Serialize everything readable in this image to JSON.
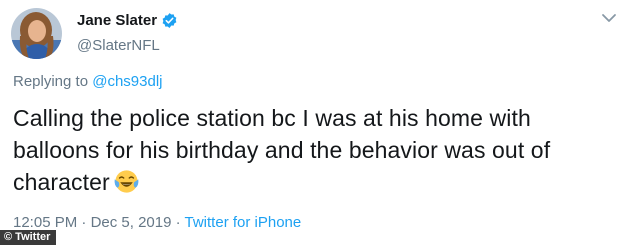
{
  "tweet": {
    "display_name": "Jane Slater",
    "handle": "@SlaterNFL",
    "replying_prefix": "Replying to ",
    "replying_to": "@chs93dlj",
    "text": "Calling the police station bc I was at his home with balloons for his birthday and the behavior was out of character",
    "time": "12:05 PM",
    "separator": " · ",
    "date": "Dec 5, 2019",
    "source": "Twitter for iPhone"
  },
  "icons": {
    "verified": "verified-badge-icon",
    "menu": "chevron-down-icon",
    "emoji": "tears-of-joy-emoji"
  },
  "credit": "© Twitter",
  "colors": {
    "link": "#1da1f2",
    "secondary_text": "#657786",
    "primary_text": "#14171a"
  }
}
